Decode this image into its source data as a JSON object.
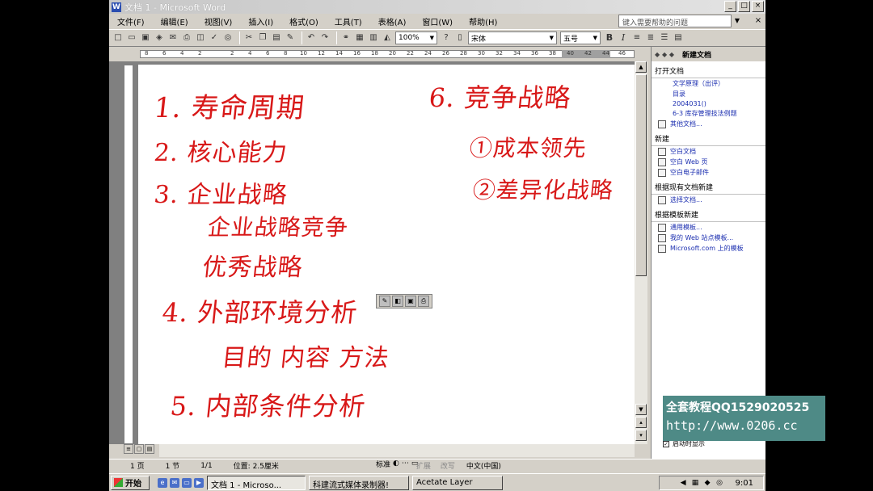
{
  "window": {
    "title": "文档 1 - Microsoft Word",
    "buttons": {
      "minimize": "_",
      "maximize": "□",
      "close": "×"
    }
  },
  "menu": {
    "items": [
      "文件(F)",
      "编辑(E)",
      "视图(V)",
      "插入(I)",
      "格式(O)",
      "工具(T)",
      "表格(A)",
      "窗口(W)",
      "帮助(H)"
    ],
    "help_placeholder": "键入需要帮助的问题",
    "doc_close": "×"
  },
  "toolbar": {
    "zoom": "100%",
    "font": "宋体",
    "size": "五号",
    "bold": "B",
    "italic": "I"
  },
  "ruler": {
    "ticks": [
      "8",
      "6",
      "4",
      "2",
      "2",
      "4",
      "6",
      "8",
      "10",
      "12",
      "14",
      "16",
      "18",
      "20",
      "22",
      "24",
      "26",
      "28",
      "30",
      "32",
      "34",
      "36",
      "38",
      "40",
      "42",
      "44",
      "46"
    ]
  },
  "handwriting": [
    {
      "id": "line-1",
      "text": "1. 寿命周期"
    },
    {
      "id": "line-2",
      "text": "2. 核心能力"
    },
    {
      "id": "line-3",
      "text": "3. 企业战略"
    },
    {
      "id": "line-3a",
      "text": "企业战略竞争"
    },
    {
      "id": "line-3b",
      "text": "优秀战略"
    },
    {
      "id": "line-4",
      "text": "4. 外部环境分析"
    },
    {
      "id": "line-4a",
      "text": "目的  内容  方法"
    },
    {
      "id": "line-5",
      "text": "5. 内部条件分析"
    },
    {
      "id": "line-6",
      "text": "6. 竞争战略"
    },
    {
      "id": "line-6a",
      "text": "①成本领先"
    },
    {
      "id": "line-6b",
      "text": "②差异化战略"
    }
  ],
  "task_pane": {
    "title": "新建文档",
    "nav": "◆ ◆ ◆",
    "sections": {
      "open": "打开文档",
      "new": "新建",
      "from_existing": "根据现有文档新建",
      "from_template": "根据模板新建"
    },
    "recent_docs": [
      "文学原理（出评）",
      "目录",
      "2004031()",
      "6-3 库存管理技法例题"
    ],
    "more_docs": "其他文档...",
    "new_items": [
      "空白文档",
      "空白 Web 页",
      "空白电子邮件"
    ],
    "choose_doc": "选择文档...",
    "templates": [
      "通用模板...",
      "我的 Web 站点模板...",
      "Microsoft.com 上的模板"
    ],
    "show_at_startup": "启动时显示"
  },
  "status": {
    "page": "1 页",
    "section": "1 节",
    "count": "1/1",
    "position": "位置:  2.5厘米",
    "extras": [
      "扩展",
      "改写"
    ],
    "lang": "中文(中国)"
  },
  "draw_toolbar": {
    "label": "标准"
  },
  "taskbar": {
    "start": "开始",
    "tasks": [
      "文档 1 - Microso...",
      "科建流式媒体录制器!",
      "Acetate Layer"
    ],
    "clock": "9:01"
  },
  "watermark": {
    "line1": "全套教程QQ1529020525",
    "line2": "http://www.0206.cc"
  }
}
